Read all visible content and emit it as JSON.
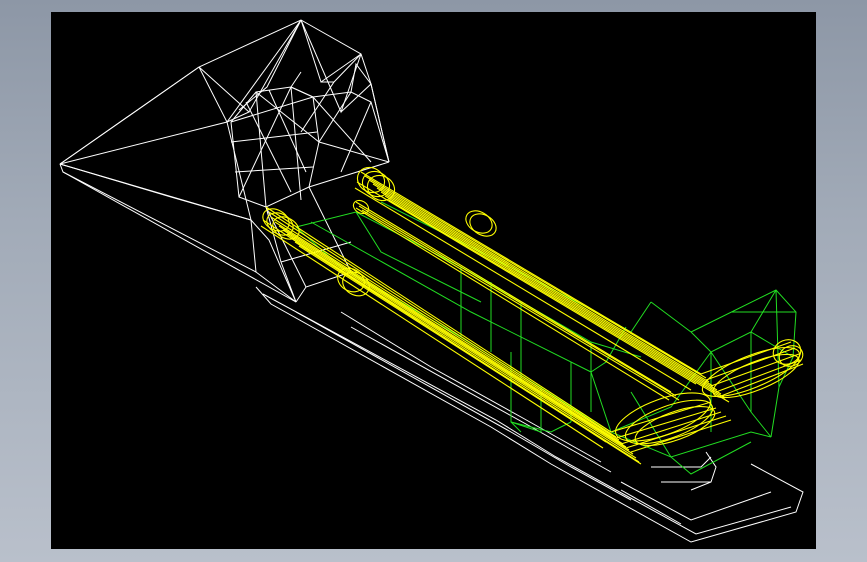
{
  "colors": {
    "background_outer": "#a2abb8",
    "viewport_background": "#000000",
    "wire_body": "#ffffff",
    "wire_tubes": "#ffff00",
    "wire_frame": "#22dd22"
  },
  "viewport": {
    "content": "cad-wireframe-model"
  }
}
